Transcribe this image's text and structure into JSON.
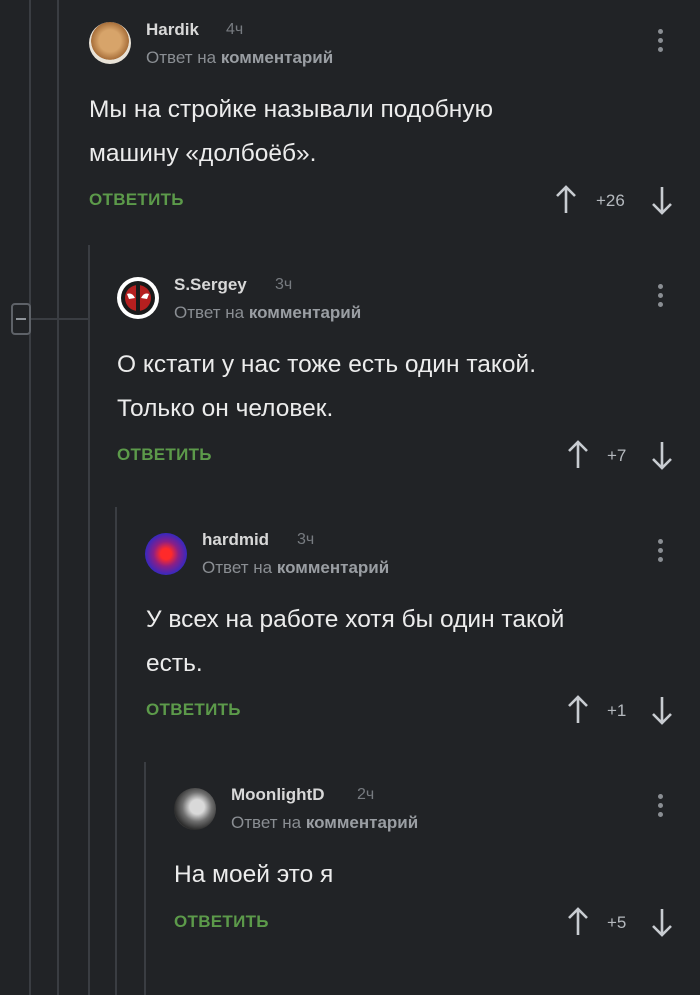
{
  "comments": [
    {
      "username": "Hardik",
      "time": "4ч",
      "reply_prefix": "Ответ на",
      "reply_target": "комментарий",
      "text_lines": [
        "Мы на стройке называли подобную",
        "машину «долбоёб»."
      ],
      "reply_label": "ОТВЕТИТЬ",
      "rating": "+26",
      "avatar": "dog-avatar"
    },
    {
      "username": "S.Sergey",
      "time": "3ч",
      "reply_prefix": "Ответ на",
      "reply_target": "комментарий",
      "text_lines": [
        "О кстати у нас тоже есть один такой.",
        "Только он человек."
      ],
      "reply_label": "ОТВЕТИТЬ",
      "rating": "+7",
      "avatar": "deadpool-avatar"
    },
    {
      "username": "hardmid",
      "time": "3ч",
      "reply_prefix": "Ответ на",
      "reply_target": "комментарий",
      "text_lines": [
        "У всех на работе хотя бы один такой",
        "есть."
      ],
      "reply_label": "ОТВЕТИТЬ",
      "rating": "+1",
      "avatar": "gradient-orb-avatar"
    },
    {
      "username": "MoonlightD",
      "time": "2ч",
      "reply_prefix": "Ответ на",
      "reply_target": "комментарий",
      "text_lines": [
        "На моей это я"
      ],
      "reply_label": "ОТВЕТИТЬ",
      "rating": "+5",
      "avatar": "portrait-avatar"
    }
  ],
  "colors": {
    "background": "#212326",
    "reply_green": "#5c9a4a",
    "thread_line": "#3a3d42"
  }
}
